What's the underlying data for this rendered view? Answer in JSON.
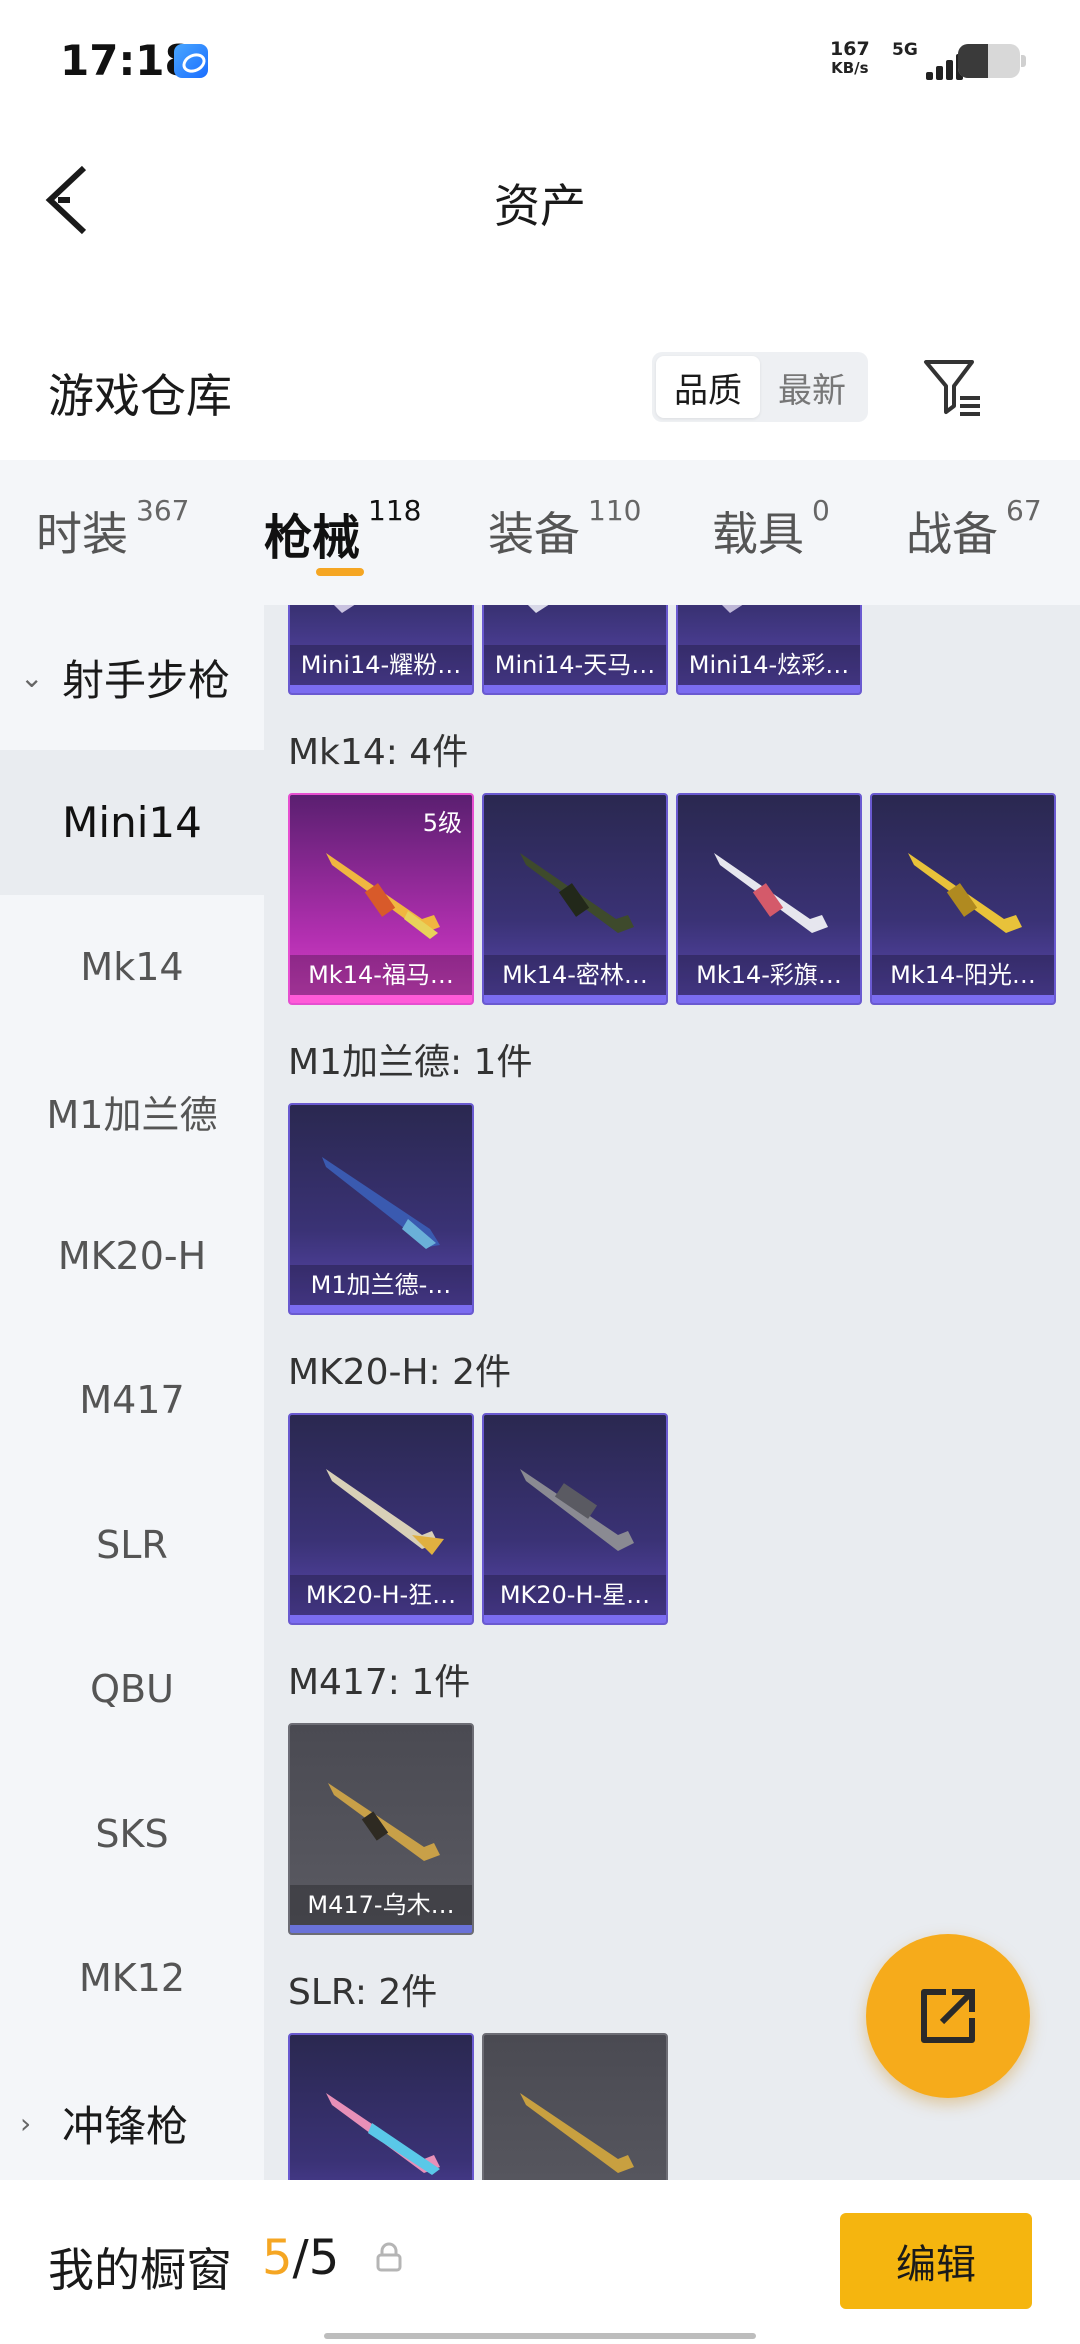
{
  "status_bar": {
    "time": "17:18",
    "speed_value": "167",
    "speed_unit": "KB/s",
    "network": "5G"
  },
  "nav": {
    "title": "资产"
  },
  "warehouse": {
    "title": "游戏仓库",
    "sort_options": [
      "品质",
      "最新"
    ],
    "sort_selected": "品质"
  },
  "tabs": [
    {
      "label": "时装",
      "count": "367"
    },
    {
      "label": "枪械",
      "count": "118"
    },
    {
      "label": "装备",
      "count": "110"
    },
    {
      "label": "载具",
      "count": "0"
    },
    {
      "label": "战备",
      "count": "67"
    }
  ],
  "active_tab": "枪械",
  "sidebar": {
    "group_expanded": "射手步枪",
    "items": [
      "Mini14",
      "Mk14",
      "M1加兰德",
      "MK20-H",
      "M417",
      "SLR",
      "QBU",
      "SKS",
      "MK12"
    ],
    "active_item": "Mini14",
    "group_collapsed": "冲锋枪"
  },
  "sections": {
    "mini14": {
      "cards": [
        "Mini14-耀粉…",
        "Mini14-天马…",
        "Mini14-炫彩…"
      ]
    },
    "mk14": {
      "label": "Mk14: 4件",
      "cards": [
        "Mk14-福马…",
        "Mk14-密林…",
        "Mk14-彩旗…",
        "Mk14-阳光…"
      ],
      "first_level": "5级"
    },
    "m1": {
      "label": "M1加兰德: 1件",
      "cards": [
        "M1加兰德-…"
      ]
    },
    "mk20": {
      "label": "MK20-H: 2件",
      "cards": [
        "MK20-H-狂…",
        "MK20-H-星…"
      ]
    },
    "m417": {
      "label": "M417: 1件",
      "cards": [
        "M417-乌木…"
      ]
    },
    "slr": {
      "label": "SLR: 2件"
    }
  },
  "showcase": {
    "title": "我的橱窗",
    "current": "5",
    "separator": "/",
    "total": "5",
    "edit_label": "编辑"
  },
  "colors": {
    "accent": "#f5a623",
    "edit_button": "#f5b50f",
    "card_purple": "#3a3275",
    "card_pink": "#b530b2",
    "card_grey": "#5b5b63"
  }
}
